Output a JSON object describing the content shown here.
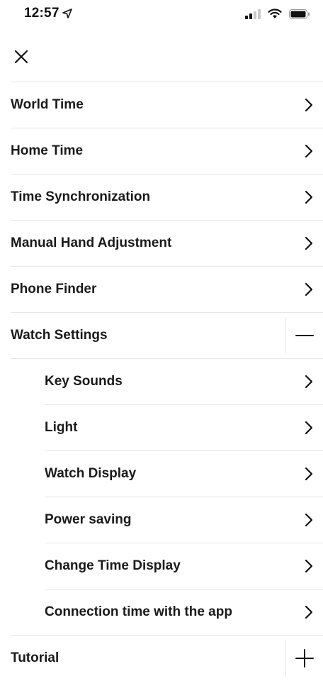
{
  "status_bar": {
    "time": "12:57",
    "icons": [
      "location-arrow-icon",
      "signal-icon",
      "wifi-icon",
      "battery-icon"
    ]
  },
  "header": {
    "close_icon": "close-icon"
  },
  "menu": {
    "items": [
      {
        "label": "World Time",
        "icon": "chevron-right-icon"
      },
      {
        "label": "Home Time",
        "icon": "chevron-right-icon"
      },
      {
        "label": "Time Synchronization",
        "icon": "chevron-right-icon"
      },
      {
        "label": "Manual Hand Adjustment",
        "icon": "chevron-right-icon"
      },
      {
        "label": "Phone Finder",
        "icon": "chevron-right-icon"
      },
      {
        "label": "Watch Settings",
        "icon": "minus-icon",
        "expanded": true,
        "children": [
          {
            "label": "Key Sounds",
            "icon": "chevron-right-icon"
          },
          {
            "label": "Light",
            "icon": "chevron-right-icon"
          },
          {
            "label": "Watch Display",
            "icon": "chevron-right-icon"
          },
          {
            "label": "Power saving",
            "icon": "chevron-right-icon"
          },
          {
            "label": "Change Time Display",
            "icon": "chevron-right-icon"
          },
          {
            "label": "Connection time with the app",
            "icon": "chevron-right-icon"
          }
        ]
      },
      {
        "label": "Tutorial",
        "icon": "plus-icon",
        "expanded": false
      }
    ]
  },
  "colors": {
    "text": "#1a1a1a",
    "divider": "#e6e6e6",
    "background": "#ffffff"
  }
}
